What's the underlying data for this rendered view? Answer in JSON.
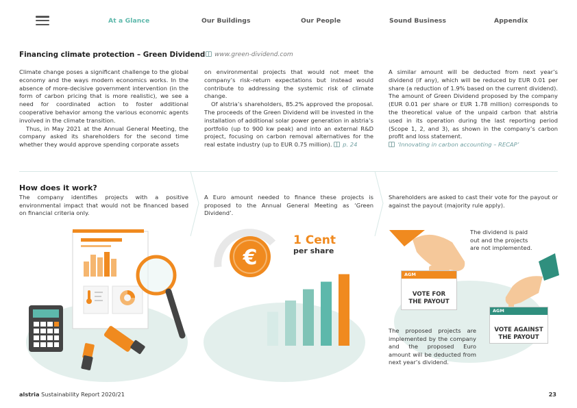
{
  "nav": {
    "menu_icon": "hamburger-menu-icon",
    "items": [
      "At a Glance",
      "Our Buildings",
      "Our People",
      "Sound Business",
      "Appendix"
    ],
    "active": "At a Glance"
  },
  "section": {
    "title": "Financing climate protection – Green Dividend",
    "link": "www.green-dividend.com",
    "col1_p1": "Climate change poses a significant challenge to the global economy and the ways modern economics works. In the absence of more-decisive government intervention (in the form of carbon pricing that is more realistic), we see a need for coordinated action to foster additional cooperative behavior among the various economic agents involved in the climate transition.",
    "col1_p2": "Thus, in May 2021 at the Annual General Meeting, the company asked its shareholders for the second time whether they would approve spending corporate assets",
    "col2_p1": "on environmental projects that would not meet the company’s risk–return expectations but instead would contribute to addressing the systemic risk of climate change.",
    "col2_p2": "Of alstria’s shareholders, 85.2% approved the proposal. The proceeds of the Green Dividend will be invested in the installation of additional solar power generation in alstria’s portfolio (up to 900 kw peak) and into an external R&D project, focusing on carbon removal alternatives for the real estate industry (up to EUR 0.75 million).",
    "col2_ref": "p. 24",
    "col3_p1": "A similar amount will be deducted from next year’s dividend (if any), which will be reduced by EUR 0.01 per share (a reduction of 1.9% based on the current dividend). The amount of Green Dividend proposed by the company (EUR 0.01 per share or EUR 1.78 million) corresponds to the theoretical value of the unpaid carbon that alstria used in its operation during the last reporting period (Scope 1, 2, and 3), as shown in the company’s carbon profit and loss statement.",
    "col3_ref": "‘Innovating in carbon accounting – RECAP’"
  },
  "how": {
    "title": "How does it work?",
    "step1": "The company identifies projects with a positive environmental impact that would not be financed based on financial criteria only.",
    "step2": "A Euro amount needed to finance these projects is proposed to the Annual General Meeting as ‘Green Dividend’.",
    "step3": "Shareholders are asked to cast their vote for the payout or against the payout (majority rule apply).",
    "cent_big": "1 Cent",
    "cent_small": "per share",
    "euro_symbol": "€",
    "ballot_tag": "AGM",
    "vote_for": "VOTE FOR THE PAYOUT",
    "vote_against": "VOTE AGAINST THE PAYOUT",
    "note_against": "The dividend is paid out and the projects are not implemented.",
    "note_for": "The proposed projects are implemented by the company and the proposed Euro amount will be deducted from next year’s dividend."
  },
  "footer": {
    "brand": "alstria",
    "report": "Sustainability Report 2020/21",
    "page": "23"
  },
  "colors": {
    "accent_teal": "#5db8ab",
    "orange": "#f08a1f",
    "light_teal": "#e3efec",
    "dark_teal": "#2f8f7e"
  },
  "bar_chart": {
    "values": [
      45,
      60,
      75,
      85,
      95
    ],
    "colors": [
      "#d7ebe7",
      "#a9d6cd",
      "#7fc3b6",
      "#5db8ab",
      "#f08a1f"
    ]
  }
}
